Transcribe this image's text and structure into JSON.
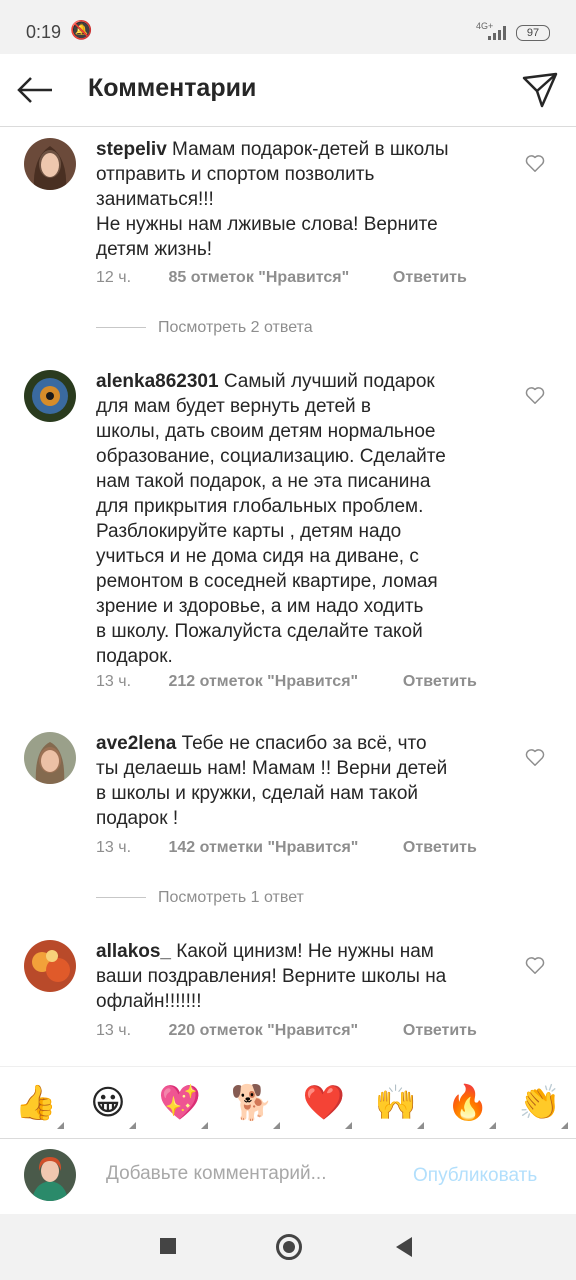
{
  "status_bar": {
    "time": "0:19",
    "network": "4G+",
    "battery": "97"
  },
  "header": {
    "title": "Комментарии"
  },
  "comments": [
    {
      "username": "stepeliv",
      "text": " Мамам подарок-детей в школы\nотправить и спортом позволить\nзаниматься!!!\nНе нужны нам лживые слова! Верните\nдетям жизнь!",
      "time": "12 ч.",
      "likes": "85 отметок \"Нравится\"",
      "reply": "Ответить",
      "view_replies": "Посмотреть 2 ответа"
    },
    {
      "username": "alenka862301",
      "text": " Самый лучший подарок\nдля мам будет вернуть детей в\nшколы, дать своим детям нормальное\nобразование, социализацию. Сделайте\nнам такой подарок, а не эта писанина\nдля прикрытия глобальных проблем.\nРазблокируйте карты , детям надо\nучиться и не дома сидя на диване, с\nремонтом в соседней квартире, ломая\nзрение и здоровье, а им надо ходить\nв школу. Пожалуйста сделайте такой\nподарок.",
      "time": "13 ч.",
      "likes": "212 отметок \"Нравится\"",
      "reply": "Ответить"
    },
    {
      "username": "ave2lena",
      "text": " Тебе не спасибо за всё, что\nты делаешь нам! Мамам !! Верни детей\nв школы и кружки, сделай нам такой\nподарок !",
      "time": "13 ч.",
      "likes": "142 отметки \"Нравится\"",
      "reply": "Ответить",
      "view_replies": "Посмотреть 1 ответ"
    },
    {
      "username": "allakos_",
      "text": " Какой цинизм! Не нужны нам\nваши поздравления! Верните школы на\nофлайн!!!!!!!",
      "time": "13 ч.",
      "likes": "220 отметок \"Нравится\"",
      "reply": "Ответить"
    }
  ],
  "emoji_bar": [
    "👍",
    "😀",
    "💖",
    "🐕",
    "❤️",
    "🙌",
    "🔥",
    "👏"
  ],
  "composer": {
    "placeholder": "Добавьте комментарий...",
    "publish_label": "Опубликовать"
  },
  "colors": {
    "link_disabled": "#b2dffc",
    "meta_gray": "#8e8e8e"
  },
  "icons": {
    "back": "arrow-left-icon",
    "share": "paper-plane-icon",
    "like": "heart-outline-icon"
  }
}
